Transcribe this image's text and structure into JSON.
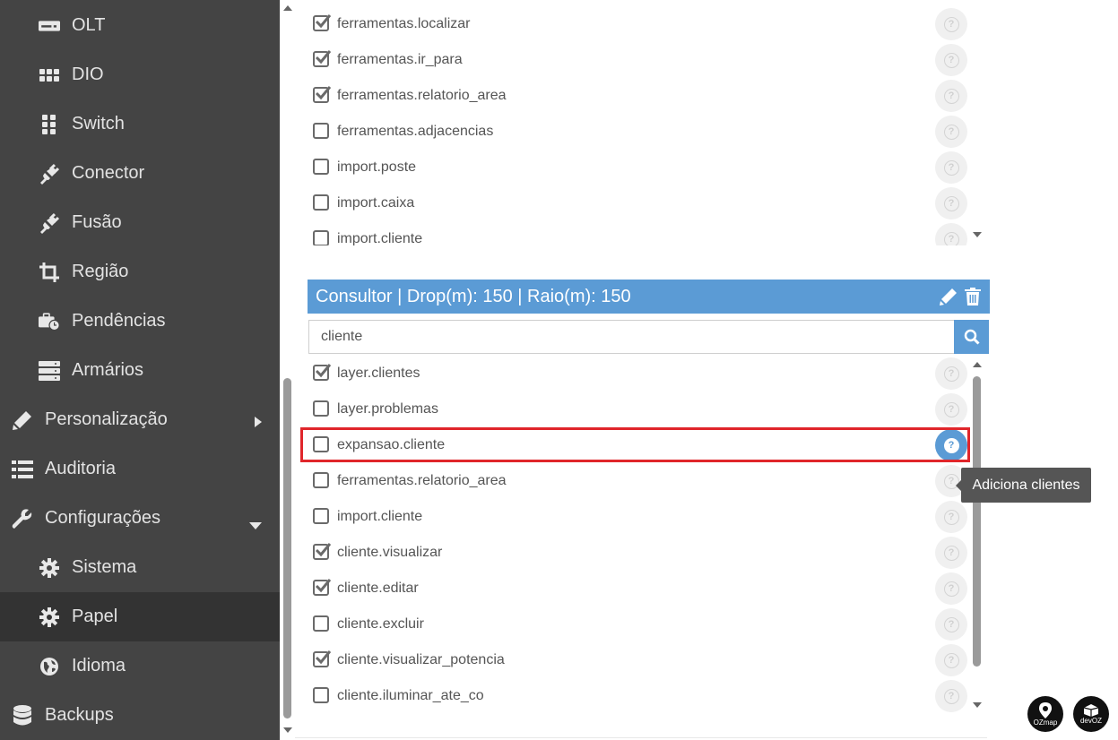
{
  "sidebar": {
    "items": [
      {
        "label": "OLT",
        "icon": "olt-icon"
      },
      {
        "label": "DIO",
        "icon": "dio-icon"
      },
      {
        "label": "Switch",
        "icon": "switch-icon"
      },
      {
        "label": "Conector",
        "icon": "plug-icon"
      },
      {
        "label": "Fusão",
        "icon": "plug-icon"
      },
      {
        "label": "Região",
        "icon": "crop-icon"
      },
      {
        "label": "Pendências",
        "icon": "briefcase-clock-icon"
      },
      {
        "label": "Armários",
        "icon": "server-icon"
      },
      {
        "label": "Personalização",
        "icon": "pencil-icon"
      },
      {
        "label": "Auditoria",
        "icon": "list-icon"
      },
      {
        "label": "Configurações",
        "icon": "wrench-icon"
      },
      {
        "label": "Sistema",
        "icon": "gear-icon"
      },
      {
        "label": "Papel",
        "icon": "gear-icon"
      },
      {
        "label": "Idioma",
        "icon": "globe-icon"
      },
      {
        "label": "Backups",
        "icon": "database-icon"
      }
    ],
    "active": "Papel"
  },
  "top_list": {
    "permissions": [
      {
        "name": "ferramentas.localizar",
        "checked": true
      },
      {
        "name": "ferramentas.ir_para",
        "checked": true
      },
      {
        "name": "ferramentas.relatorio_area",
        "checked": true
      },
      {
        "name": "ferramentas.adjacencias",
        "checked": false
      },
      {
        "name": "import.poste",
        "checked": false
      },
      {
        "name": "import.caixa",
        "checked": false
      },
      {
        "name": "import.cliente",
        "checked": false
      }
    ]
  },
  "role": {
    "title": "Consultor | Drop(m): 150 | Raio(m): 150",
    "edit_icon": "pencil-icon",
    "delete_icon": "trash-icon"
  },
  "search": {
    "value": "cliente",
    "button_icon": "search-icon"
  },
  "bottom_list": {
    "permissions": [
      {
        "name": "layer.clientes",
        "checked": true
      },
      {
        "name": "layer.problemas",
        "checked": false
      },
      {
        "name": "expansao.cliente",
        "checked": false,
        "highlighted": true
      },
      {
        "name": "ferramentas.relatorio_area",
        "checked": false
      },
      {
        "name": "import.cliente",
        "checked": false
      },
      {
        "name": "cliente.visualizar",
        "checked": true
      },
      {
        "name": "cliente.editar",
        "checked": true
      },
      {
        "name": "cliente.excluir",
        "checked": false
      },
      {
        "name": "cliente.visualizar_potencia",
        "checked": true
      },
      {
        "name": "cliente.iluminar_ate_co",
        "checked": false
      }
    ]
  },
  "tooltip": {
    "text": "Adiciona clientes"
  },
  "help_symbol": "?",
  "logos": [
    {
      "text": "OZmap"
    },
    {
      "text": "devOZ"
    }
  ],
  "colors": {
    "sidebar_bg": "#444444",
    "sidebar_active": "#333333",
    "accent": "#5b9bd5",
    "highlight": "#e0262b",
    "tooltip_bg": "#555555"
  }
}
